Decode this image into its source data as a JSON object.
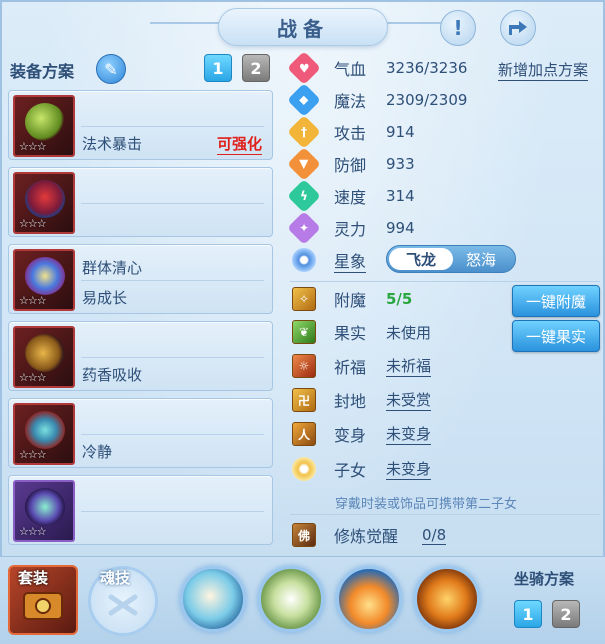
{
  "header": {
    "title": "战备",
    "info_icon": "exclamation-icon",
    "share_icon": "share-icon"
  },
  "equip_plan": {
    "label": "装备方案",
    "edit_icon": "pencil-icon",
    "plans": [
      "1",
      "2"
    ],
    "active_plan": "1"
  },
  "slots": [
    {
      "lines": [
        "法术暴击"
      ],
      "tag": "可强化",
      "stars": "☆☆☆"
    },
    {
      "lines": [],
      "tag": "",
      "stars": "☆☆☆"
    },
    {
      "lines": [
        "群体清心",
        "易成长"
      ],
      "tag": "",
      "stars": "☆☆☆"
    },
    {
      "lines": [
        "药香吸收"
      ],
      "tag": "",
      "stars": "☆☆☆"
    },
    {
      "lines": [
        "冷静"
      ],
      "tag": "",
      "stars": "☆☆☆"
    },
    {
      "lines": [],
      "tag": "",
      "stars": "☆☆☆"
    }
  ],
  "stats": [
    {
      "name": "气血",
      "value": "3236/3236",
      "color": "#ef5a7a"
    },
    {
      "name": "魔法",
      "value": "2309/2309",
      "color": "#3aa0ef"
    },
    {
      "name": "攻击",
      "value": "914",
      "color": "#f2b53a"
    },
    {
      "name": "防御",
      "value": "933",
      "color": "#f2913a"
    },
    {
      "name": "速度",
      "value": "314",
      "color": "#2dc99a"
    },
    {
      "name": "灵力",
      "value": "994",
      "color": "#b67be6"
    }
  ],
  "add_point_plan": "新增加点方案",
  "star_sign": {
    "label": "星象",
    "options": [
      "飞龙",
      "怒海"
    ],
    "selected": "飞龙"
  },
  "extras": [
    {
      "name": "附魔",
      "value": "5/5",
      "link": false,
      "green": true
    },
    {
      "name": "果实",
      "value": "未使用",
      "link": false,
      "green": false
    },
    {
      "name": "祈福",
      "value": "未祈福",
      "link": true,
      "green": false
    },
    {
      "name": "封地",
      "value": "未受赏",
      "link": true,
      "green": false
    },
    {
      "name": "变身",
      "value": "未变身",
      "link": true,
      "green": false
    },
    {
      "name": "子女",
      "value": "未变身",
      "link": true,
      "green": false
    }
  ],
  "buttons": {
    "one_click_enchant": "一键附魔",
    "one_click_fruit": "一键果实"
  },
  "hint": "穿戴时装或饰品可携带第二子女",
  "cultivation": {
    "name": "修炼觉醒",
    "value": "0/8"
  },
  "bottom": {
    "suit_label": "套装",
    "soul_label": "魂技",
    "mount_plan_label": "坐骑方案",
    "mount_plans": [
      "1",
      "2"
    ],
    "active_mount_plan": "1"
  }
}
